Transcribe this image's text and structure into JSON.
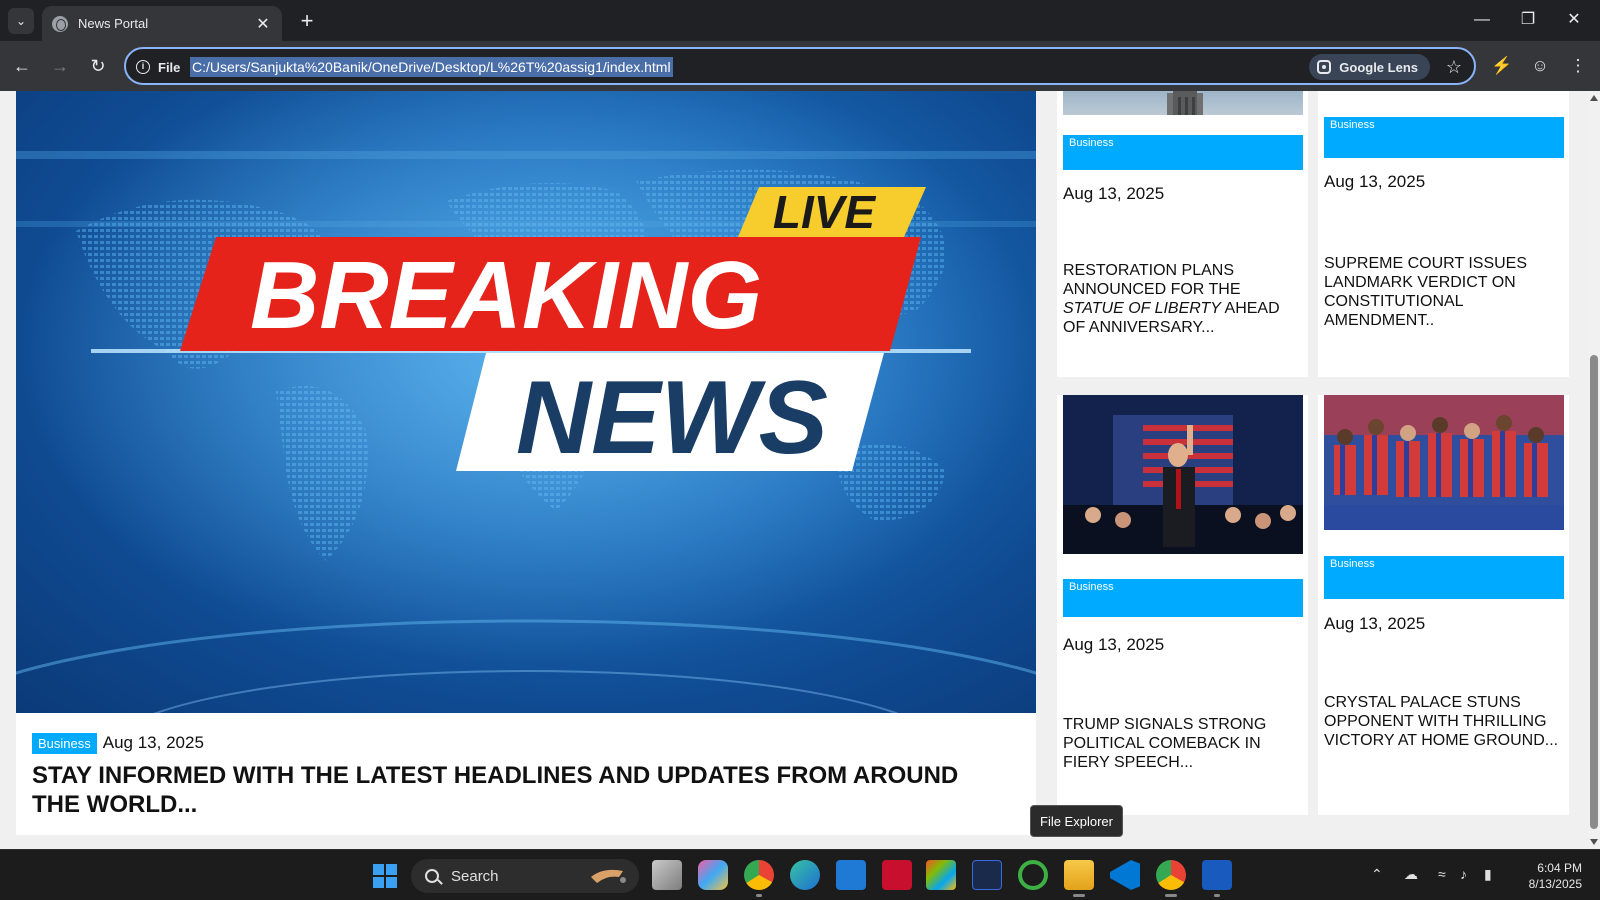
{
  "browser": {
    "tab_title": "News Portal",
    "site_label": "File",
    "url": "C:/Users/Sanjukta%20Banik/OneDrive/Desktop/L%26T%20assig1/index.html",
    "lens_label": "Google Lens"
  },
  "hero": {
    "tag": "LIVE",
    "line1": "BREAKING",
    "line2": "NEWS"
  },
  "featured": {
    "category": "Business",
    "date": "Aug 13, 2025",
    "headline": "STAY INFORMED WITH THE LATEST HEADLINES AND UPDATES FROM AROUND THE WORLD..."
  },
  "cards": [
    {
      "category": "Business",
      "date": "Aug 13, 2025",
      "title_pre": "RESTORATION PLANS ANNOUNCED FOR THE ",
      "title_em": "STATUE OF LIBERTY",
      "title_post": " AHEAD OF ANNIVERSARY..."
    },
    {
      "category": "Business",
      "date": "Aug 13, 2025",
      "title": "SUPREME COURT ISSUES LANDMARK VERDICT ON CONSTITUTIONAL AMENDMENT.."
    },
    {
      "category": "Business",
      "date": "Aug 13, 2025",
      "title": "TRUMP SIGNALS STRONG POLITICAL COMEBACK IN FIERY SPEECH..."
    },
    {
      "category": "Business",
      "date": "Aug 13, 2025",
      "title": "CRYSTAL PALACE STUNS OPPONENT WITH THRILLING VICTORY AT HOME GROUND..."
    }
  ],
  "tooltip": "File Explorer",
  "taskbar": {
    "search_label": "Search",
    "time": "6:04 PM",
    "date": "8/13/2025"
  }
}
